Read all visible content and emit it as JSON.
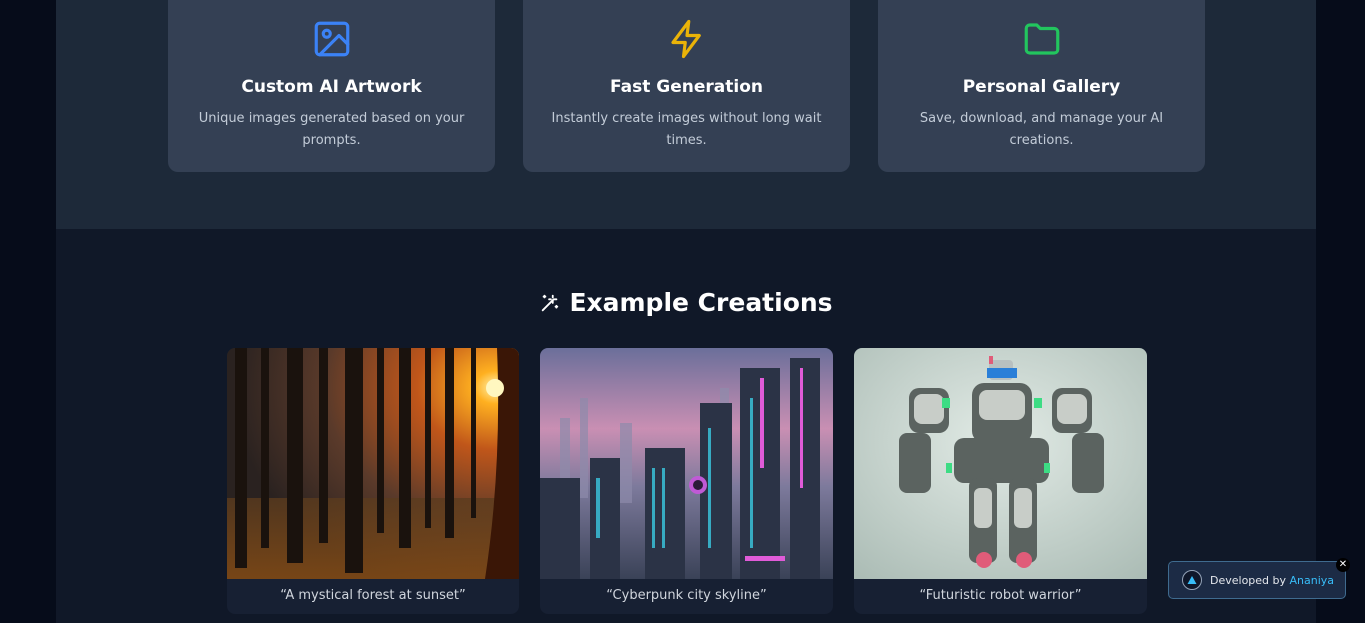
{
  "features": [
    {
      "icon": "image-icon",
      "title": "Custom AI Artwork",
      "desc": "Unique images generated based on your prompts.",
      "color": "#3b82f6"
    },
    {
      "icon": "lightning-icon",
      "title": "Fast Generation",
      "desc": "Instantly create images without long wait times.",
      "color": "#eab308"
    },
    {
      "icon": "folder-icon",
      "title": "Personal Gallery",
      "desc": "Save, download, and manage your AI creations.",
      "color": "#22c55e"
    }
  ],
  "examples": {
    "title": "Example Creations",
    "items": [
      {
        "caption": "“A mystical forest at sunset”"
      },
      {
        "caption": "“Cyberpunk city skyline”"
      },
      {
        "caption": "“Futuristic robot warrior”"
      }
    ]
  },
  "badge": {
    "prefix": "Developed by",
    "name": "Ananiya",
    "close": "✕"
  }
}
